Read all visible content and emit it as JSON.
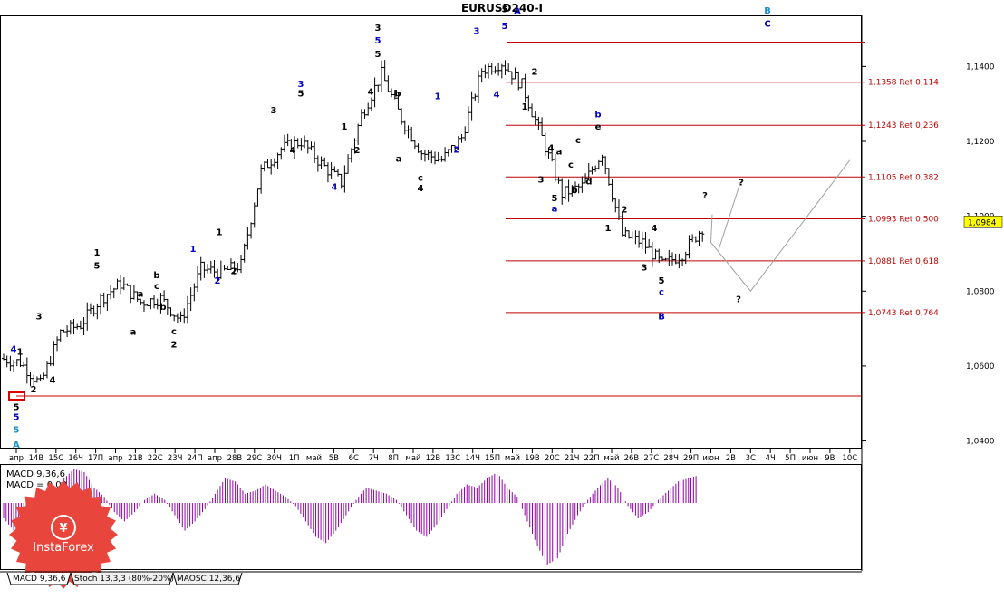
{
  "chart_title": "EURUSD240-I",
  "price_axis": {
    "ylim": [
      1.0382,
      1.1534
    ],
    "ticks": [
      "1,1400",
      "1,1200",
      "1,1000",
      "1,0800",
      "1,0600",
      "1,0400"
    ],
    "tick_values": [
      1.14,
      1.12,
      1.1,
      1.08,
      1.06,
      1.04
    ],
    "current_price": "1,0984",
    "current_value": 1.0984,
    "current_color": "#ffff00"
  },
  "time_axis": {
    "labels": [
      "апр",
      "14В",
      "15С",
      "16Ч",
      "17П",
      "апр",
      "21В",
      "22С",
      "23Ч",
      "24П",
      "апр",
      "28В",
      "29С",
      "30Ч",
      "1П",
      "май",
      "5В",
      "6С",
      "7Ч",
      "8П",
      "май",
      "12В",
      "13С",
      "14Ч",
      "15П",
      "май",
      "19В",
      "20С",
      "21Ч",
      "22П",
      "май",
      "26В",
      "27С",
      "28Ч",
      "29П",
      "июн",
      "2В",
      "3С",
      "4Ч",
      "5П",
      "июн",
      "9В",
      "10С"
    ]
  },
  "fib_levels": [
    {
      "label": "",
      "value": 1.1465
    },
    {
      "label": "1,1358 Ret 0,114",
      "value": 1.1358
    },
    {
      "label": "1,1243 Ret 0,236",
      "value": 1.1243
    },
    {
      "label": "1,1105 Ret 0,382",
      "value": 1.1105
    },
    {
      "label": "1,0993 Ret 0,500",
      "value": 1.0993
    },
    {
      "label": "1,0881 Ret 0,618",
      "value": 1.0881
    },
    {
      "label": "1,0743 Ret 0,764",
      "value": 1.0743
    }
  ],
  "support_line": {
    "value": 1.052
  },
  "colors": {
    "fib": "#c00000",
    "support": "#c00000",
    "bars": "#000000",
    "macd": "#9400a8",
    "blue": "#0000c8",
    "cyan": "#1e90c8",
    "projection": "#a0a0a0"
  },
  "chart_data": {
    "type": "ohlc",
    "title": "EURUSD240-I",
    "xlabel": "",
    "ylabel": "",
    "x": [
      "апр",
      "14В",
      "15С",
      "16Ч",
      "17П",
      "апр",
      "21В",
      "22С",
      "23Ч",
      "24П",
      "апр",
      "28В",
      "29С",
      "30Ч",
      "1П",
      "май",
      "5В",
      "6С",
      "7Ч",
      "8П",
      "май",
      "12В",
      "13С",
      "14Ч",
      "15П",
      "май",
      "19В",
      "20С",
      "21Ч",
      "22П",
      "май",
      "26В",
      "27С",
      "28Ч",
      "29П"
    ],
    "series": [
      {
        "values": [
          1.061,
          1.055,
          1.069,
          1.071,
          1.078,
          1.082,
          1.077,
          1.078,
          1.072,
          1.086,
          1.085,
          1.087,
          1.112,
          1.118,
          1.12,
          1.114,
          1.109,
          1.127,
          1.138,
          1.126,
          1.117,
          1.115,
          1.121,
          1.139,
          1.141,
          1.135,
          1.121,
          1.106,
          1.108,
          1.117,
          1.095,
          1.093,
          1.087,
          1.09,
          1.097
        ]
      }
    ],
    "ylim": [
      1.0382,
      1.1534
    ],
    "grid": false,
    "projection": [
      {
        "x": "29П",
        "y": 1.1005
      },
      {
        "x": "июн",
        "y": 1.093
      },
      {
        "x": "3С",
        "y": 1.08
      },
      {
        "x": "10С",
        "y": 1.115
      }
    ],
    "projection_alt": [
      {
        "x": "29П",
        "y": 1.1005
      },
      {
        "x": "2В",
        "y": 1.109
      }
    ]
  },
  "wave_labels": [
    {
      "text": "4",
      "x": 15,
      "v": 1.0637,
      "c": "#0000c8"
    },
    {
      "text": "1",
      "x": 22,
      "v": 1.063,
      "c": "#000"
    },
    {
      "text": "5",
      "x": 18,
      "v": 1.0483,
      "c": "#000"
    },
    {
      "text": "5",
      "x": 18,
      "v": 1.0456,
      "c": "#0000c8"
    },
    {
      "text": "5",
      "x": 18,
      "v": 1.0422,
      "c": "#1e90c8"
    },
    {
      "text": "A",
      "x": 18,
      "v": 1.0382,
      "c": "#1e90c8"
    },
    {
      "text": "2",
      "x": 37,
      "v": 1.053,
      "c": "#000"
    },
    {
      "text": "3",
      "x": 43,
      "v": 1.0725,
      "c": "#000"
    },
    {
      "text": "4",
      "x": 58,
      "v": 1.0555,
      "c": "#000"
    },
    {
      "text": "1",
      "x": 107,
      "v": 1.0895,
      "c": "#000"
    },
    {
      "text": "5",
      "x": 107,
      "v": 1.086,
      "c": "#000"
    },
    {
      "text": "a",
      "x": 155,
      "v": 1.0785,
      "c": "#000"
    },
    {
      "text": "a",
      "x": 147,
      "v": 1.0683,
      "c": "#000"
    },
    {
      "text": "b",
      "x": 173,
      "v": 1.0835,
      "c": "#000"
    },
    {
      "text": "c",
      "x": 173,
      "v": 1.0805,
      "c": "#000"
    },
    {
      "text": "b",
      "x": 180,
      "v": 1.075,
      "c": "#000"
    },
    {
      "text": "c",
      "x": 192,
      "v": 1.0685,
      "c": "#000"
    },
    {
      "text": "2",
      "x": 192,
      "v": 1.065,
      "c": "#000"
    },
    {
      "text": "1",
      "x": 213,
      "v": 1.0905,
      "c": "#0000c8"
    },
    {
      "text": "1",
      "x": 242,
      "v": 1.095,
      "c": "#000"
    },
    {
      "text": "2",
      "x": 240,
      "v": 1.082,
      "c": "#0000c8"
    },
    {
      "text": "2",
      "x": 258,
      "v": 1.0845,
      "c": "#000"
    },
    {
      "text": "3",
      "x": 302,
      "v": 1.1275,
      "c": "#000"
    },
    {
      "text": "3",
      "x": 332,
      "v": 1.1345,
      "c": "#0000c8"
    },
    {
      "text": "5",
      "x": 332,
      "v": 1.132,
      "c": "#000"
    },
    {
      "text": "4",
      "x": 323,
      "v": 1.1168,
      "c": "#000"
    },
    {
      "text": "4",
      "x": 369,
      "v": 1.107,
      "c": "#0000c8"
    },
    {
      "text": "1",
      "x": 380,
      "v": 1.1232,
      "c": "#000"
    },
    {
      "text": "2",
      "x": 394,
      "v": 1.1168,
      "c": "#000"
    },
    {
      "text": "3",
      "x": 417,
      "v": 1.1495,
      "c": "#000"
    },
    {
      "text": "5",
      "x": 417,
      "v": 1.1462,
      "c": "#0000c8"
    },
    {
      "text": "5",
      "x": 417,
      "v": 1.1425,
      "c": "#000"
    },
    {
      "text": "4",
      "x": 409,
      "v": 1.1325,
      "c": "#000"
    },
    {
      "text": "b",
      "x": 439,
      "v": 1.132,
      "c": "#000"
    },
    {
      "text": "a",
      "x": 440,
      "v": 1.1145,
      "c": "#000"
    },
    {
      "text": "c",
      "x": 464,
      "v": 1.1095,
      "c": "#000"
    },
    {
      "text": "4",
      "x": 464,
      "v": 1.1067,
      "c": "#000"
    },
    {
      "text": "1",
      "x": 483,
      "v": 1.1312,
      "c": "#0000c8"
    },
    {
      "text": "2",
      "x": 504,
      "v": 1.117,
      "c": "#0000c8"
    },
    {
      "text": "3",
      "x": 526,
      "v": 1.1487,
      "c": "#0000c8"
    },
    {
      "text": "4",
      "x": 548,
      "v": 1.1318,
      "c": "#0000c8"
    },
    {
      "text": "5",
      "x": 557,
      "v": 1.1545,
      "c": "#000"
    },
    {
      "text": "5",
      "x": 557,
      "v": 1.15,
      "c": "#0000c8"
    },
    {
      "text": "A",
      "x": 571,
      "v": 1.154,
      "c": "#0000c8"
    },
    {
      "text": "2",
      "x": 590,
      "v": 1.1378,
      "c": "#000"
    },
    {
      "text": "1",
      "x": 579,
      "v": 1.1285,
      "c": "#000"
    },
    {
      "text": "4",
      "x": 608,
      "v": 1.1175,
      "c": "#000"
    },
    {
      "text": "a",
      "x": 617,
      "v": 1.1165,
      "c": "#000"
    },
    {
      "text": "3",
      "x": 597,
      "v": 1.109,
      "c": "#000"
    },
    {
      "text": "c",
      "x": 630,
      "v": 1.113,
      "c": "#000"
    },
    {
      "text": "5",
      "x": 612,
      "v": 1.104,
      "c": "#000"
    },
    {
      "text": "a",
      "x": 612,
      "v": 1.1012,
      "c": "#0000c8"
    },
    {
      "text": "b",
      "x": 634,
      "v": 1.1062,
      "c": "#000"
    },
    {
      "text": "d",
      "x": 650,
      "v": 1.1085,
      "c": "#000"
    },
    {
      "text": "e",
      "x": 660,
      "v": 1.1232,
      "c": "#000"
    },
    {
      "text": "b",
      "x": 660,
      "v": 1.1264,
      "c": "#0000c8"
    },
    {
      "text": "c",
      "x": 638,
      "v": 1.1195,
      "c": "#000"
    },
    {
      "text": "2",
      "x": 689,
      "v": 1.101,
      "c": "#000"
    },
    {
      "text": "1",
      "x": 671,
      "v": 1.096,
      "c": "#000"
    },
    {
      "text": "4",
      "x": 722,
      "v": 1.096,
      "c": "#000"
    },
    {
      "text": "3",
      "x": 711,
      "v": 1.0855,
      "c": "#000"
    },
    {
      "text": "5",
      "x": 730,
      "v": 1.082,
      "c": "#000"
    },
    {
      "text": "c",
      "x": 730,
      "v": 1.079,
      "c": "#0000c8"
    },
    {
      "text": "B",
      "x": 730,
      "v": 1.0725,
      "c": "#0000c8"
    },
    {
      "text": "?",
      "x": 778,
      "v": 1.1048,
      "c": "#000"
    },
    {
      "text": "?",
      "x": 818,
      "v": 1.1083,
      "c": "#000"
    },
    {
      "text": "?",
      "x": 815,
      "v": 1.077,
      "c": "#000"
    },
    {
      "text": "B",
      "x": 847,
      "v": 1.1541,
      "c": "#1e90c8"
    },
    {
      "text": "C",
      "x": 847,
      "v": 1.1506,
      "c": "#0000c8"
    }
  ],
  "macd": {
    "label_1": "MACD 9,36,6",
    "label_2": "MACD = 0,00",
    "values": [
      -0.5,
      -0.9,
      -1.0,
      -0.7,
      -0.2,
      0.3,
      0.8,
      1.1,
      1.0,
      0.5,
      0.2,
      -0.3,
      -0.6,
      -0.3,
      0.1,
      0.3,
      0.1,
      -0.4,
      -0.9,
      -0.6,
      -0.2,
      0.3,
      0.8,
      0.7,
      0.3,
      0.4,
      0.6,
      0.4,
      0.2,
      -0.1,
      -0.6,
      -1.1,
      -1.3,
      -0.9,
      -0.4,
      0.1,
      0.5,
      0.4,
      0.3,
      0.1,
      -0.4,
      -0.9,
      -1.1,
      -0.7,
      -0.2,
      0.3,
      0.6,
      0.5,
      0.8,
      1.0,
      0.5,
      0.2,
      -0.6,
      -1.4,
      -2.0,
      -1.8,
      -1.0,
      -0.4,
      0.1,
      0.5,
      0.8,
      0.5,
      -0.1,
      -0.5,
      -0.3,
      0.1,
      0.4,
      0.7,
      0.8,
      0.9
    ]
  },
  "tabs": [
    {
      "label": "MACD 9,36,6"
    },
    {
      "label": "Stoch 13,3,3 (80%-20%)"
    },
    {
      "label": "MAOSC 12,36,6"
    }
  ],
  "logo": {
    "text": "InstaForex"
  }
}
